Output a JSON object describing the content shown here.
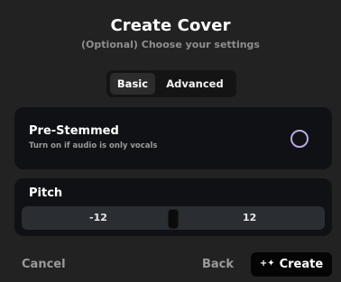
{
  "dialog": {
    "title": "Create Cover",
    "subtitle": "(Optional) Choose your settings"
  },
  "tabs": [
    {
      "label": "Basic",
      "active": true
    },
    {
      "label": "Advanced",
      "active": false
    }
  ],
  "pre_stemmed": {
    "title": "Pre-Stemmed",
    "description": "Turn on if audio is only vocals",
    "checked": false
  },
  "pitch": {
    "title": "Pitch",
    "min_label": "-12",
    "max_label": "12",
    "value_fraction": 0.5
  },
  "footer": {
    "cancel_label": "Cancel",
    "back_label": "Back",
    "create_label": "Create",
    "create_icon": "sparkle-icon"
  },
  "colors": {
    "background": "#222222",
    "card": "#0f1114",
    "radio_accent": "#b9a7e6",
    "muted_text": "#9a9a9a"
  }
}
